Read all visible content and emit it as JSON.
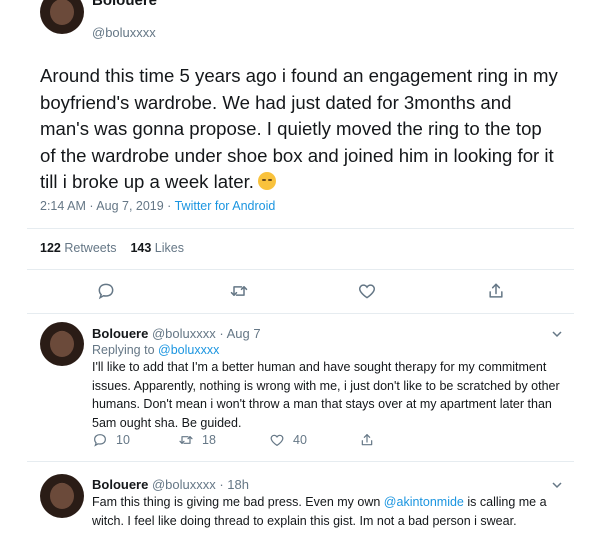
{
  "main_tweet": {
    "name": "Bolouere",
    "handle": "@boluxxxx",
    "text": "Around this time 5 years ago i found an engagement ring in my boyfriend's wardrobe. We had just dated for 3months and man's was gonna propose. I quietly moved the ring to the top of the wardrobe under shoe box and joined him in looking for it till i broke up a week later.",
    "emoji_icon": "relieved-face-emoji",
    "time": "2:14 AM · Aug 7, 2019 · ",
    "source": "Twitter for Android",
    "retweets_count": "122",
    "retweets_label": "Retweets",
    "likes_count": "143",
    "likes_label": "Likes"
  },
  "replies": [
    {
      "name": "Bolouere",
      "handle_date": "@boluxxxx · Aug 7",
      "replying_prefix": "Replying to ",
      "replying_to": "@boluxxxx",
      "text": "I'll like to add that I'm a better human and have sought therapy for my commitment issues. Apparently, nothing is wrong with me, i just don't like to be scratched by other humans. Don't mean i won't throw a man that stays over at my apartment later than 5am ought sha. Be guided.",
      "replies": "10",
      "retweets": "18",
      "likes": "40"
    },
    {
      "name": "Bolouere",
      "handle_date": "@boluxxxx · 18h",
      "text_before": "Fam this thing is giving me bad press. Even my own ",
      "mention": "@akintonmide",
      "text_after": " is calling me a witch. I feel like doing thread to explain this gist. Im not a bad person i swear."
    }
  ],
  "colors": {
    "link": "#1b95e0",
    "secondary": "#657786",
    "primary": "#14171a",
    "divider": "#e6ecf0"
  }
}
